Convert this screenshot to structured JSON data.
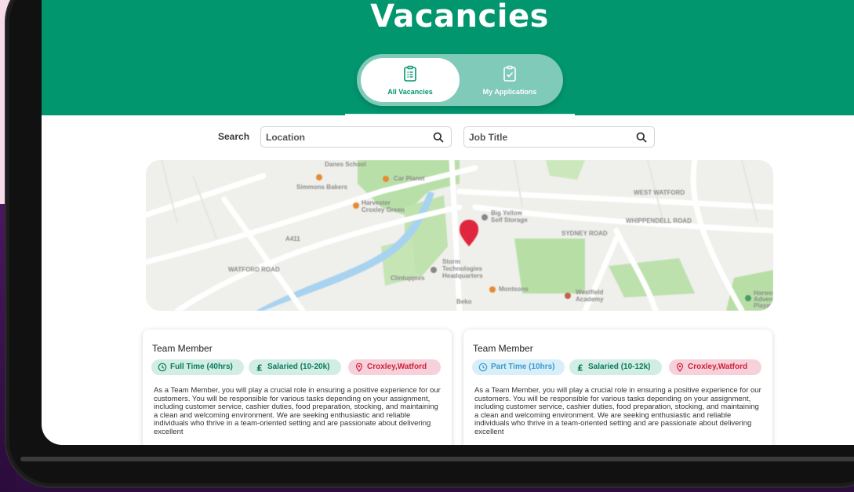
{
  "page": {
    "title": "Vacancies"
  },
  "tabs": [
    {
      "label": "All Vacancies",
      "icon": "clipboard-list-icon",
      "active": true
    },
    {
      "label": "My Applications",
      "icon": "clipboard-check-icon",
      "active": false
    }
  ],
  "search": {
    "label": "Search",
    "location_placeholder": "Location",
    "job_title_placeholder": "Job Title"
  },
  "map": {
    "labels": {
      "danes_school": "Danes School",
      "car_planet": "Car Planet",
      "simmons": "Simmons Bakers",
      "harvester": "Harvester",
      "croxley_green": "Croxley Green",
      "west_watford": "WEST WATFORD",
      "whippendell": "WHIPPENDELL ROAD",
      "big_yellow": "Big Yellow",
      "self_storage": "Self Storage",
      "sydney_road": "SYDNEY ROAD",
      "watford_road": "WATFORD ROAD",
      "storm": "Storm",
      "technologies": "Technologies",
      "headquarters": "Headquarters",
      "clintupples": "Clintupples",
      "montsons": "Montsons",
      "westfield": "Westfield",
      "academy": "Academy",
      "beko": "Beko",
      "harwood": "Harwo",
      "advent": "Adven",
      "playground": "Playg",
      "a411": "A411"
    },
    "colors": {
      "green": "#b7dfa5",
      "water": "#a8d3f0",
      "pin": "#e0263f"
    }
  },
  "vacancies": [
    {
      "title": "Team Member",
      "hours": "Full Time (40hrs)",
      "hours_style": "green",
      "salary": "Salaried (10-20k)",
      "location": "Croxley,Watford",
      "description": "As a Team Member, you will play a crucial role in ensuring a positive experience for our customers. You will be responsible for various tasks depending on your assignment, including customer service, cashier duties, food preparation, stocking, and maintaining a clean and welcoming environment. We are seeking enthusiastic and reliable individuals who thrive in a team-oriented setting and are passionate about delivering excellent"
    },
    {
      "title": "Team Member",
      "hours": "Part Time (10hrs)",
      "hours_style": "blue",
      "salary": "Salaried (10-12k)",
      "location": "Croxley,Watford",
      "description": "As a Team Member, you will play a crucial role in ensuring a positive experience for our customers. You will be responsible for various tasks depending on your assignment, including customer service, cashier duties, food preparation, stocking, and maintaining a clean and welcoming environment. We are seeking enthusiastic and reliable individuals who thrive in a team-oriented setting and are passionate about delivering excellent"
    }
  ],
  "theme": {
    "primary": "#02966f",
    "tab_track": "#7fcab8"
  }
}
